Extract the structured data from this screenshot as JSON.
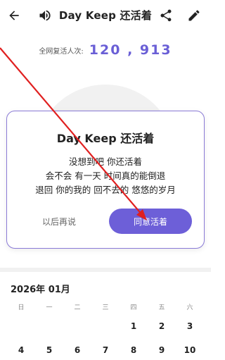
{
  "topbar": {
    "title": "Day Keep 还活着",
    "back_icon": "arrow-left-icon",
    "sound_icon": "volume-icon",
    "share_icon": "share-icon",
    "edit_icon": "pencil-icon"
  },
  "counter": {
    "label": "全网复活人次:",
    "value": "120 , 913"
  },
  "dialog": {
    "title": "Day Keep 还活着",
    "lines": [
      "没想到吧 你还活着",
      "会不会 有一天 时间真的能倒退",
      "退回 你的我的 回不去的 悠悠的岁月"
    ],
    "cancel_label": "以后再说",
    "ok_label": "同意活着"
  },
  "calendar": {
    "month": "2026年 01月",
    "weekdays": [
      "日",
      "一",
      "二",
      "三",
      "四",
      "五",
      "六"
    ],
    "week1": [
      "",
      "",
      "",
      "",
      "1",
      "2",
      "3"
    ],
    "week2": [
      "4",
      "5",
      "6",
      "7",
      "8",
      "9",
      "10"
    ]
  },
  "colors": {
    "accent": "#6d5fd8",
    "counter": "#6a5fd6",
    "annotation": "#e02020"
  }
}
